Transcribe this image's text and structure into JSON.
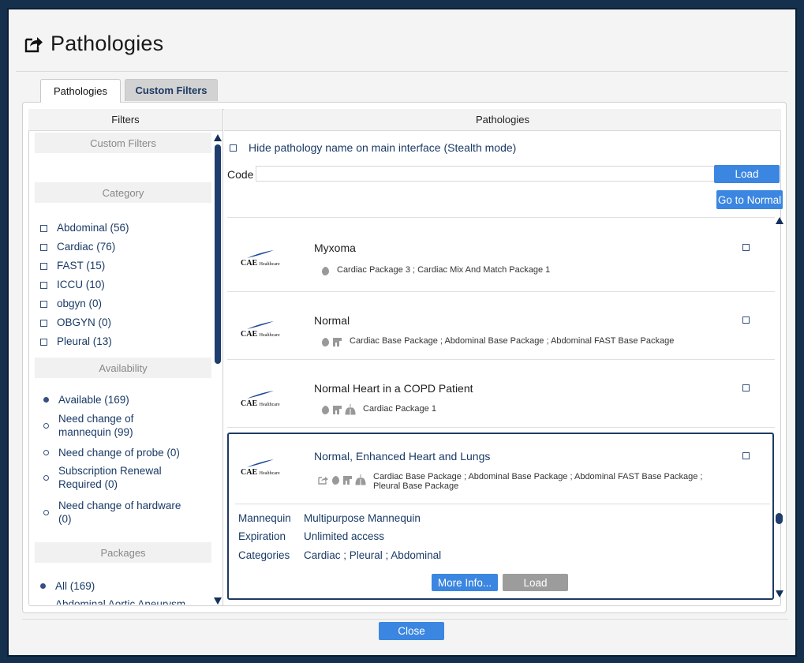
{
  "window": {
    "title": "Pathologies"
  },
  "tabs": [
    {
      "label": "Pathologies"
    },
    {
      "label": "Custom Filters"
    }
  ],
  "filters": {
    "header": "Filters",
    "custom_filters_title": "Custom Filters",
    "category_title": "Category",
    "categories": [
      {
        "label": "Abdominal (56)"
      },
      {
        "label": "Cardiac (76)"
      },
      {
        "label": "FAST (15)"
      },
      {
        "label": "ICCU (10)"
      },
      {
        "label": "obgyn (0)"
      },
      {
        "label": "OBGYN (0)"
      },
      {
        "label": "Pleural (13)"
      }
    ],
    "availability_title": "Availability",
    "availability": [
      {
        "label": "Available (169)",
        "selected": true
      },
      {
        "label": "Need change of mannequin (99)",
        "selected": false
      },
      {
        "label": "Need change of probe (0)",
        "selected": false
      },
      {
        "label": "Subscription Renewal Required (0)",
        "selected": false
      },
      {
        "label": "Need change of hardware (0)",
        "selected": false
      }
    ],
    "packages_title": "Packages",
    "packages": [
      {
        "label": "All (169)",
        "selected": true
      },
      {
        "label": "Abdominal Aortic Aneurysm",
        "selected": false
      }
    ]
  },
  "pathologies": {
    "header": "Pathologies",
    "stealth_label": "Hide pathology name on main interface (Stealth mode)",
    "code_label": "Code",
    "code_value": "",
    "load_button": "Load",
    "go_normal_button": "Go to Normal",
    "logo_text": "CAE",
    "logo_sub": "Healthcare",
    "items": [
      {
        "name": "Myxoma",
        "packages": "Cardiac Package 3 ; Cardiac Mix And Match Package 1",
        "icons": [
          "heart-icon"
        ]
      },
      {
        "name": "Normal",
        "packages": "Cardiac Base Package ; Abdominal Base Package ; Abdominal FAST Base Package",
        "icons": [
          "heart-icon",
          "abdomen-icon"
        ]
      },
      {
        "name": "Normal Heart in a COPD Patient",
        "packages": "Cardiac Package 1",
        "icons": [
          "heart-icon",
          "abdomen-icon",
          "lungs-icon"
        ]
      },
      {
        "name": "Normal, Enhanced Heart and Lungs",
        "packages": "Cardiac Base Package ; Abdominal Base Package ; Abdominal FAST Base Package ; Pleural Base Package",
        "icons": [
          "share-icon",
          "heart-icon",
          "abdomen-icon",
          "lungs-icon"
        ]
      }
    ],
    "details": {
      "mannequin_label": "Mannequin",
      "mannequin_value": "Multipurpose Mannequin",
      "expiration_label": "Expiration",
      "expiration_value": "Unlimited access",
      "categories_label": "Categories",
      "categories_value": "Cardiac ; Pleural ; Abdominal",
      "more_info_button": "More Info...",
      "load_button": "Load"
    }
  },
  "footer": {
    "close_button": "Close"
  },
  "colors": {
    "accent": "#3b86e0",
    "navy": "#1e3a63",
    "background": "#14304d"
  }
}
